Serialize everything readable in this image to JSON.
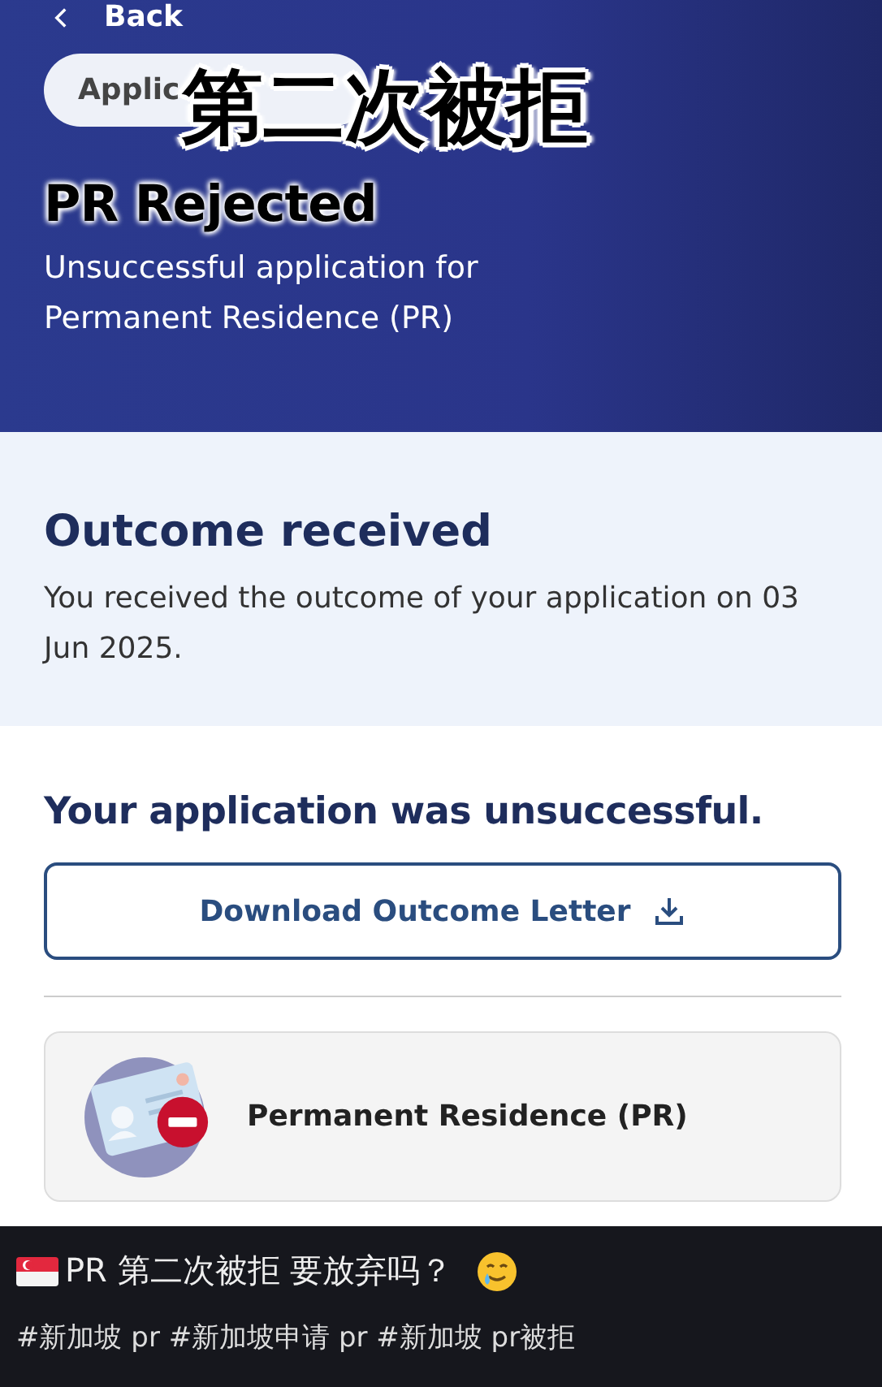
{
  "header": {
    "back": "Back",
    "chip": "Applic",
    "title": "PR Rejected",
    "subtitle": "Unsuccessful application for Permanent Residence (PR)"
  },
  "overlay_caption": "第二次被拒",
  "outcome": {
    "title": "Outcome received",
    "text": "You received the outcome of your application on 03 Jun 2025."
  },
  "result": {
    "heading": "Your application was unsuccessful.",
    "button": "Download Outcome Letter"
  },
  "card": {
    "label": "Permanent Residence (PR)"
  },
  "post": {
    "caption": "PR 第二次被拒 要放弃吗？",
    "hashtags": "#新加坡 pr #新加坡申请 pr #新加坡 pr被拒"
  }
}
